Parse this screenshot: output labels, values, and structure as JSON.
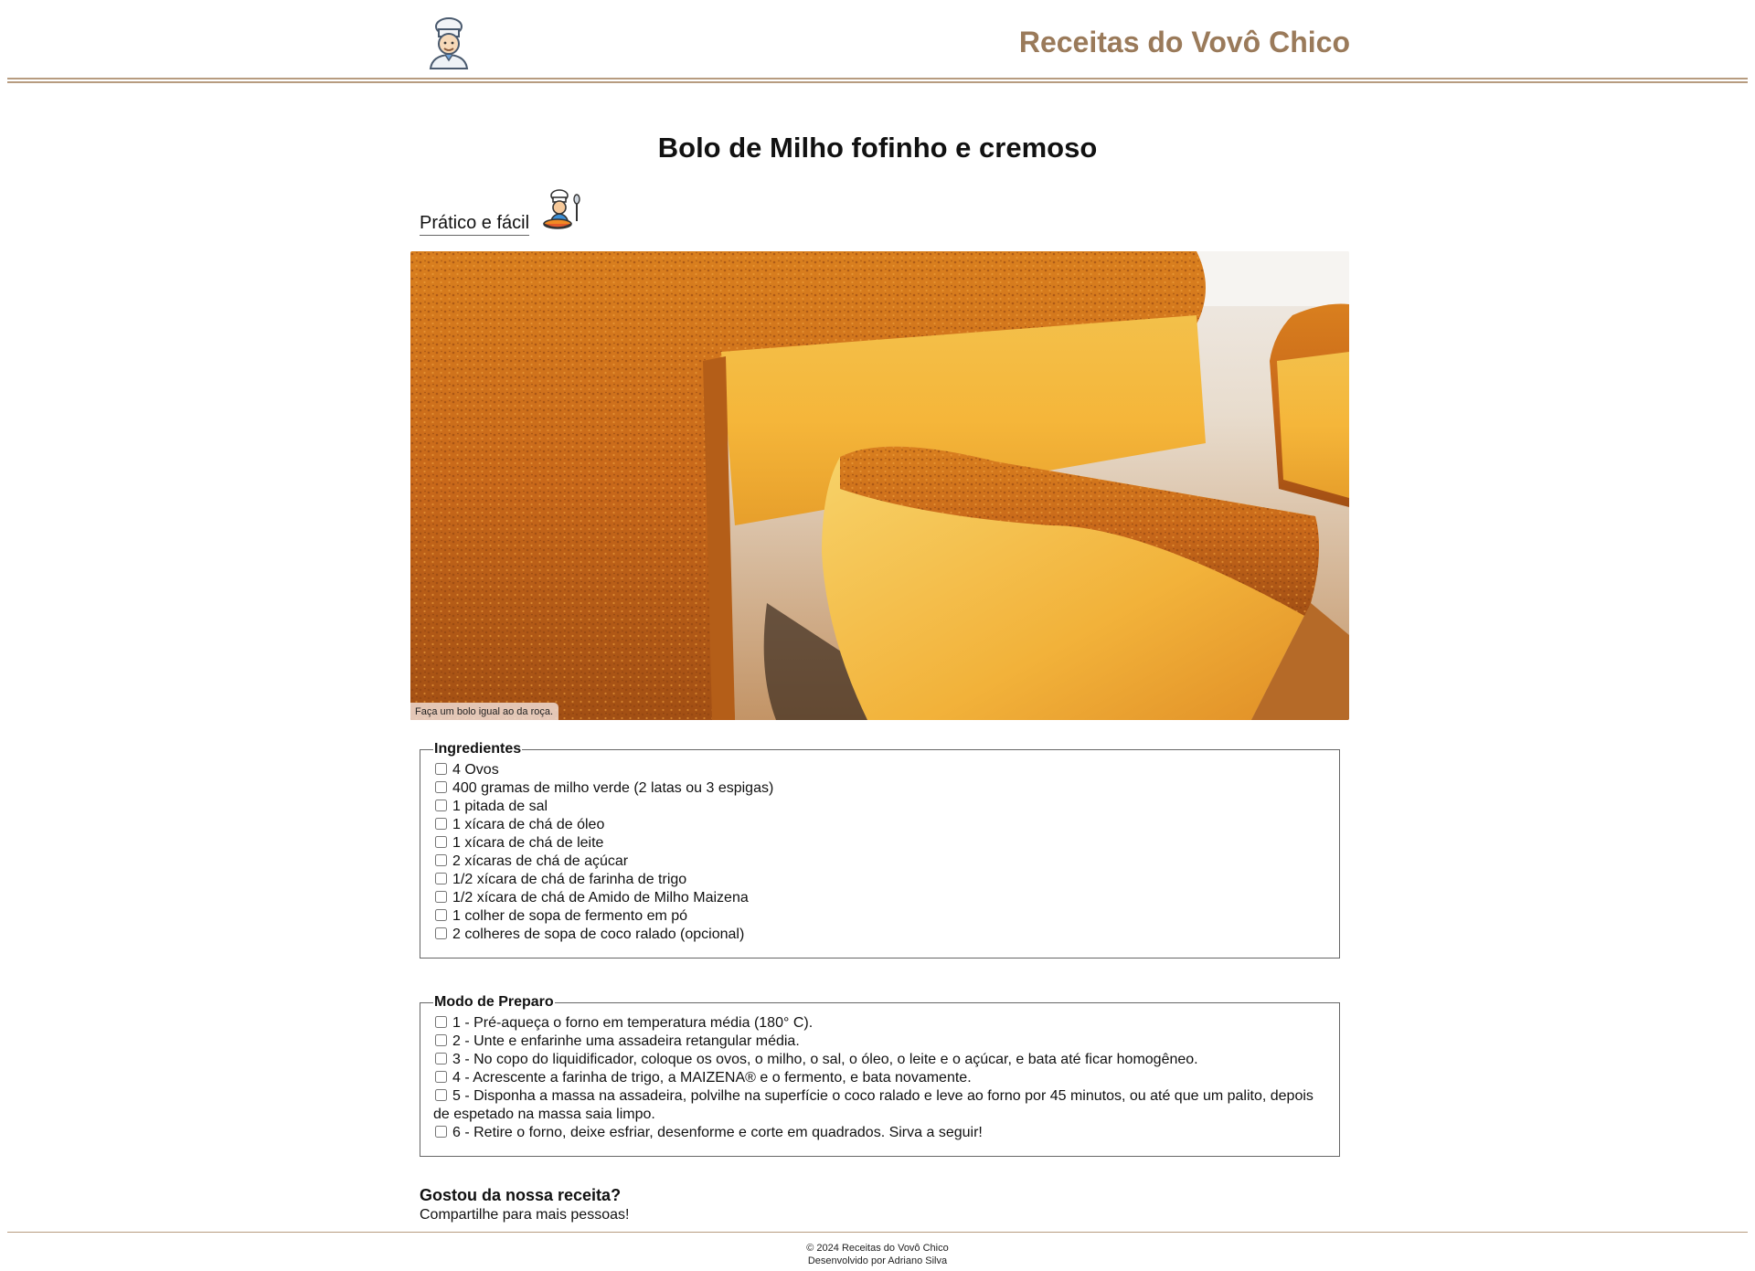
{
  "header": {
    "logo_icon": "chef-avatar-icon",
    "site_title": "Receitas do Vovô Chico"
  },
  "recipe": {
    "title": "Bolo de Milho fofinho e cremoso",
    "subtitle": "Prático e fácil",
    "subtitle_icon": "chef-cooking-icon",
    "image_caption": "Faça um bolo igual ao da roça."
  },
  "ingredients": {
    "legend": "Ingredientes",
    "items": [
      "4 Ovos",
      "400 gramas de milho verde (2 latas ou 3 espigas)",
      "1 pitada de sal",
      "1 xícara de chá de óleo",
      "1 xícara de chá de leite",
      "2 xícaras de chá de açúcar",
      "1/2 xícara de chá de farinha de trigo",
      "1/2 xícara de chá de Amido de Milho Maizena",
      "1 colher de sopa de fermento em pó",
      "2 colheres de sopa de coco ralado (opcional)"
    ]
  },
  "preparation": {
    "legend": "Modo de Preparo",
    "steps": [
      "1 - Pré-aqueça o forno em temperatura média (180° C).",
      "2 - Unte e enfarinhe uma assadeira retangular média.",
      "3 - No copo do liquidificador, coloque os ovos, o milho, o sal, o óleo, o leite e o açúcar, e bata até ficar homogêneo.",
      "4 - Acrescente a farinha de trigo, a MAIZENA® e o fermento, e bata novamente.",
      "5 - Disponha a massa na assadeira, polvilhe na superfície o coco ralado e leve ao forno por 45 minutos, ou até que um palito, depois de espetado na massa saia limpo.",
      "6 - Retire o forno, deixe esfriar, desenforme e corte em quadrados. Sirva a seguir!"
    ]
  },
  "cta": {
    "question": "Gostou da nossa receita?",
    "share_text": "Compartilhe para mais pessoas!"
  },
  "footer": {
    "copyright": "© 2024 Receitas do Vovô Chico",
    "credit": "Desenvolvido por Adriano Silva"
  },
  "colors": {
    "accent": "#9a7a5a",
    "rule": "#b79c80"
  }
}
